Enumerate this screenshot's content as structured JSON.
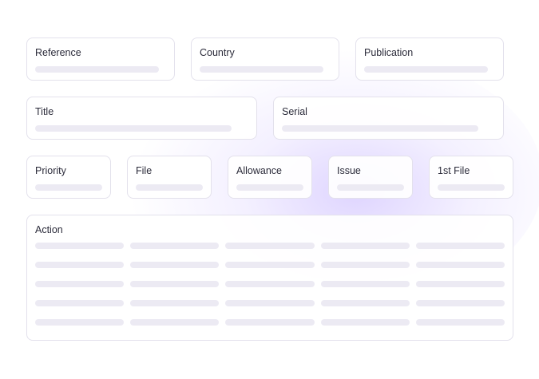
{
  "form": {
    "reference_label": "Reference",
    "country_label": "Country",
    "publication_label": "Publication",
    "title_label": "Title",
    "serial_label": "Serial",
    "priority_label": "Priority",
    "file_label": "File",
    "allowance_label": "Allowance",
    "issue_label": "Issue",
    "first_file_label": "1st File",
    "action_label": "Action"
  },
  "colors": {
    "accent_glow": "#c4b2ff",
    "card_border": "#e3e1ec",
    "placeholder": "#eceaf3"
  }
}
